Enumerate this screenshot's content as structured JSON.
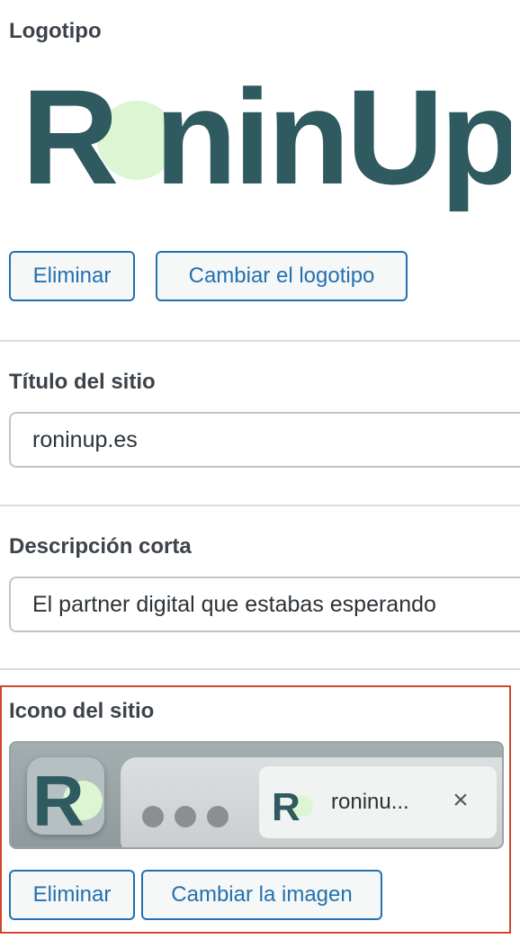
{
  "logo_section": {
    "label": "Logotipo",
    "logo_text": "RninUp",
    "remove_button": "Eliminar",
    "change_button": "Cambiar el logotipo"
  },
  "title_section": {
    "label": "Título del sitio",
    "value": "roninup.es"
  },
  "description_section": {
    "label": "Descripción corta",
    "value": "El partner digital que estabas esperando"
  },
  "icon_section": {
    "label": "Icono del sitio",
    "app_icon_letter": "R",
    "tab_favicon_letter": "R",
    "tab_title": "roninu...",
    "tab_close": "×",
    "remove_button": "Eliminar",
    "change_button": "Cambiar la imagen"
  },
  "colors": {
    "brand_dark": "#2f5a5f",
    "brand_accent": "#dcf5d2",
    "button_blue": "#2271b1",
    "highlight_border": "#d0472e"
  }
}
